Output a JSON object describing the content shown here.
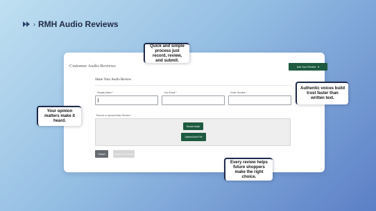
{
  "header": {
    "breadcrumb_chevron": "›",
    "title": "RMH Audio Reviews"
  },
  "card": {
    "title": "Customer Audio Reviews",
    "add_button_label": "Add Your Review",
    "add_button_caret": "▾",
    "section_title": "Share Your Audio Review",
    "fields": [
      {
        "label": "Display Name *",
        "value": ""
      },
      {
        "label": "Your Email *",
        "value": ""
      },
      {
        "label": "Order Number *",
        "value": ""
      }
    ],
    "record_label": "Record or Upload Audio Review *",
    "record_button_label": "Record Audio",
    "upload_button_label": "Upload Audio File",
    "cancel_label": "Cancel",
    "submit_label": "Submit Audio Review"
  },
  "callouts": {
    "top": "Quick and simple process just record, review, and submit.",
    "right": "Authentic voices build trust faster than written text.",
    "left": "Your opinion matters make it heard.",
    "bottom": "Every review helps future shoppers make the right choice."
  },
  "colors": {
    "accent": "#1d5a3f",
    "callout_border": "#1e2a4a",
    "background_start": "#bfe0f1",
    "background_end": "#5c7fc6"
  },
  "icons": {
    "header_icon": "fast-forward-icon",
    "dropdown_icon": "chevron-down-icon"
  }
}
